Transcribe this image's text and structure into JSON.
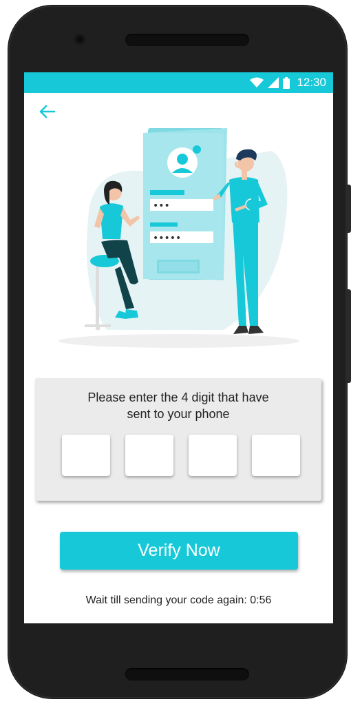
{
  "status_bar": {
    "time": "12:30",
    "wifi_icon": "wifi-icon",
    "signal_icon": "cell-signal-icon",
    "battery_icon": "battery-icon",
    "color": "#17c9d8"
  },
  "navigation": {
    "back_icon": "arrow-left-icon"
  },
  "illustration": {
    "pin_mask": "•••",
    "password_mask": "•••••"
  },
  "verification": {
    "prompt_line1": "Please enter the 4 digit that have",
    "prompt_line2": "sent to your phone",
    "digits": [
      "",
      "",
      "",
      ""
    ],
    "button_label": "Verify Now",
    "resend_text": "Wait till sending your code again: 0:56"
  },
  "colors": {
    "accent": "#17c9d8",
    "card": "#ebebeb",
    "text": "#222222"
  }
}
